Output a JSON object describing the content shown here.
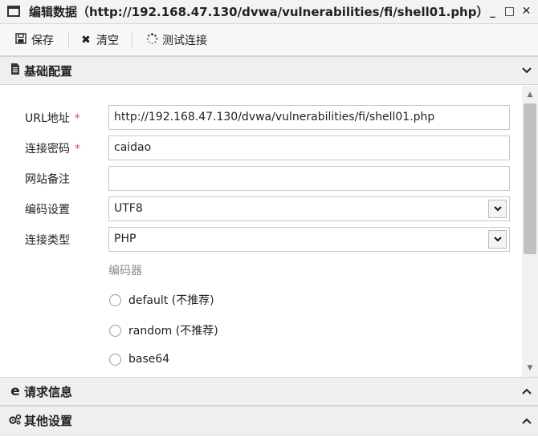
{
  "window": {
    "title": "编辑数据（http://192.168.47.130/dvwa/vulnerabilities/fi/shell01.php）",
    "minimize_glyph": "▁",
    "maximize_glyph": "☐",
    "close_glyph": "✕"
  },
  "toolbar": {
    "save_label": "保存",
    "clear_label": "清空",
    "test_label": "测试连接"
  },
  "sections": {
    "basic": {
      "label": "基础配置",
      "icon": "document-icon",
      "expanded": true
    },
    "request": {
      "label": "请求信息",
      "icon": "e-icon",
      "expanded": false
    },
    "other": {
      "label": "其他设置",
      "icon": "gears-icon",
      "expanded": false
    }
  },
  "form": {
    "url": {
      "label": "URL地址",
      "required_mark": "*",
      "value": "http://192.168.47.130/dvwa/vulnerabilities/fi/shell01.php"
    },
    "password": {
      "label": "连接密码",
      "required_mark": "*",
      "value": "caidao"
    },
    "note": {
      "label": "网站备注",
      "value": ""
    },
    "encoding": {
      "label": "编码设置",
      "value": "UTF8"
    },
    "type": {
      "label": "连接类型",
      "value": "PHP"
    },
    "encoder": {
      "title": "编码器",
      "options": [
        "default (不推荐)",
        "random (不推荐)",
        "base64"
      ]
    }
  },
  "colors": {
    "required": "#d9534f",
    "section_bg": "#efefef",
    "toolbar_bg": "#f7f7f7"
  }
}
